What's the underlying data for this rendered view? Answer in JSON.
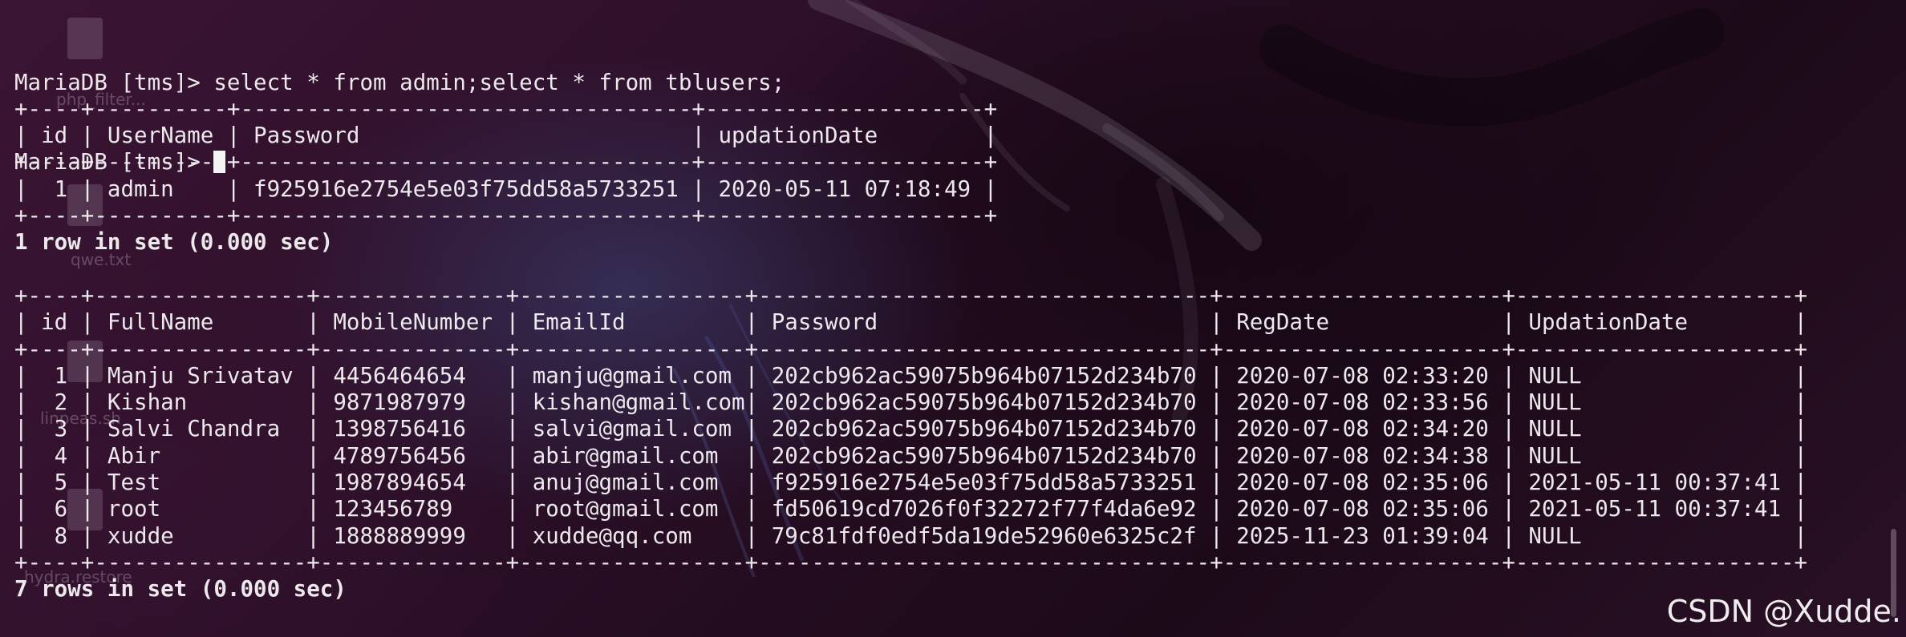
{
  "desktop": {
    "labels": [
      "php_filter...",
      "qwe.txt",
      "linpeas.sh",
      "hydra.restore"
    ]
  },
  "terminal": {
    "lines": [
      "MariaDB [tms]> select * from admin;select * from tblusers;",
      "+----+----------+----------------------------------+---------------------+",
      "| id | UserName | Password                         | updationDate        |",
      "+----+----------+----------------------------------+---------------------+",
      "|  1 | admin    | f925916e2754e5e03f75dd58a5733251 | 2020-05-11 07:18:49 |",
      "+----+----------+----------------------------------+---------------------+",
      "1 row in set (0.000 sec)",
      "",
      "+----+----------------+--------------+-----------------+----------------------------------+---------------------+---------------------+",
      "| id | FullName       | MobileNumber | EmailId         | Password                         | RegDate             | UpdationDate        |",
      "+----+----------------+--------------+-----------------+----------------------------------+---------------------+---------------------+",
      "|  1 | Manju Srivatav | 4456464654   | manju@gmail.com | 202cb962ac59075b964b07152d234b70 | 2020-07-08 02:33:20 | NULL                |",
      "|  2 | Kishan         | 9871987979   | kishan@gmail.com| 202cb962ac59075b964b07152d234b70 | 2020-07-08 02:33:56 | NULL                |",
      "|  3 | Salvi Chandra  | 1398756416   | salvi@gmail.com | 202cb962ac59075b964b07152d234b70 | 2020-07-08 02:34:20 | NULL                |",
      "|  4 | Abir           | 4789756456   | abir@gmail.com  | 202cb962ac59075b964b07152d234b70 | 2020-07-08 02:34:38 | NULL                |",
      "|  5 | Test           | 1987894654   | anuj@gmail.com  | f925916e2754e5e03f75dd58a5733251 | 2020-07-08 02:35:06 | 2021-05-11 00:37:41 |",
      "|  6 | root           | 123456789    | root@gmail.com  | fd50619cd7026f0f32272f77f4da6e92 | 2020-07-08 02:35:06 | 2021-05-11 00:37:41 |",
      "|  8 | xudde          | 1888889999   | xudde@qq.com    | 79c81fdf0edf5da19de52960e6325c2f | 2025-11-23 01:39:04 | NULL                |",
      "+----+----------------+--------------+-----------------+----------------------------------+---------------------+---------------------+",
      "7 rows in set (0.000 sec)",
      ""
    ],
    "bold_lines": [
      6,
      19
    ],
    "prompt": "MariaDB [tms]> "
  },
  "watermark": "CSDN @Xudde."
}
